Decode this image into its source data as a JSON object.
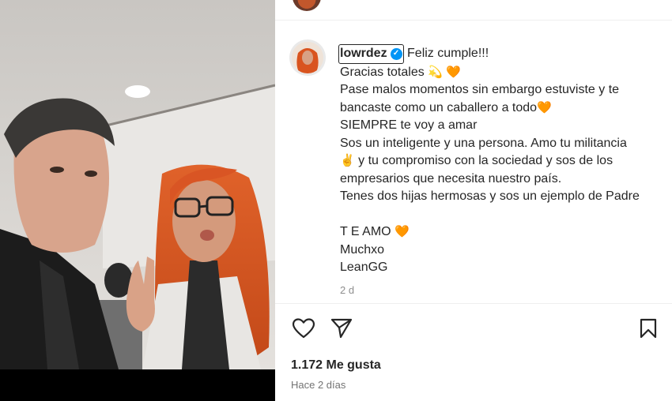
{
  "post": {
    "author_username": "lowrdez",
    "verified_icon": "verified-badge-icon",
    "caption_lines": [
      "Feliz cumple!!!",
      "Gracias totales",
      "Pase malos momentos sin embargo estuviste y te",
      "bancaste como un caballero a todo",
      "SIEMPRE te voy a amar",
      "Sos un inteligente y una persona. Amo tu militancia",
      "y tu compromiso con la sociedad y sos de los",
      "empresarios que necesita nuestro país.",
      "Tenes dos hijas hermosas y sos un ejemplo de Padre",
      "T E AMO",
      "Muchxo",
      "LeanGG"
    ],
    "comment_time": "2 d",
    "likes": "1.172 Me gusta",
    "posted_ago": "Hace 2 días"
  },
  "emojis": {
    "dizzy": "💫",
    "orange_heart": "🧡",
    "victory": "✌️"
  },
  "icons": {
    "like": "heart-outline-icon",
    "share": "send-paper-plane-icon",
    "save": "bookmark-outline-icon"
  },
  "colors": {
    "verified": "#0095f6",
    "text": "#262626",
    "secondary": "#8e8e8e",
    "divider": "#efefef"
  }
}
